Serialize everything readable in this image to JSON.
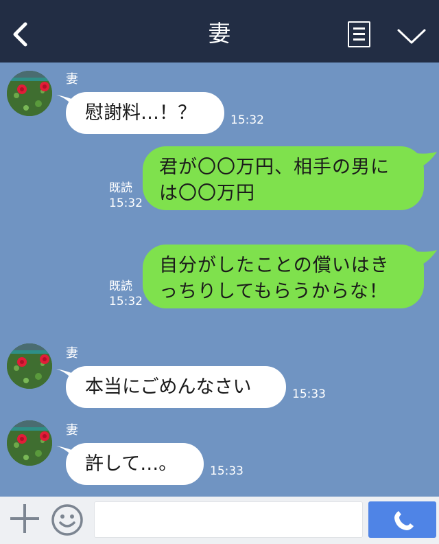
{
  "header": {
    "title": "妻"
  },
  "messages": [
    {
      "direction": "in",
      "sender": "妻",
      "text": "慰謝料…！？",
      "time": "15:32"
    },
    {
      "direction": "out",
      "text": "君が〇〇万円、相手の男には〇〇万円",
      "read": "既読",
      "time": "15:32"
    },
    {
      "direction": "out",
      "text": "自分がしたことの償いはきっちりしてもらうからな！",
      "read": "既読",
      "time": "15:32"
    },
    {
      "direction": "in",
      "sender": "妻",
      "text": "本当にごめんなさい",
      "time": "15:33"
    },
    {
      "direction": "in",
      "sender": "妻",
      "text": "許して…。",
      "time": "15:33"
    }
  ],
  "icons": {
    "back": "chevron-left-icon",
    "menu": "notes-icon",
    "collapse": "chevron-down-icon",
    "add": "plus-icon",
    "emoji": "smile-icon",
    "call": "phone-icon"
  },
  "colors": {
    "header": "#222d44",
    "background": "#7094c2",
    "outgoing": "#7fe14d",
    "incoming": "#ffffff",
    "call": "#4f84e6"
  }
}
